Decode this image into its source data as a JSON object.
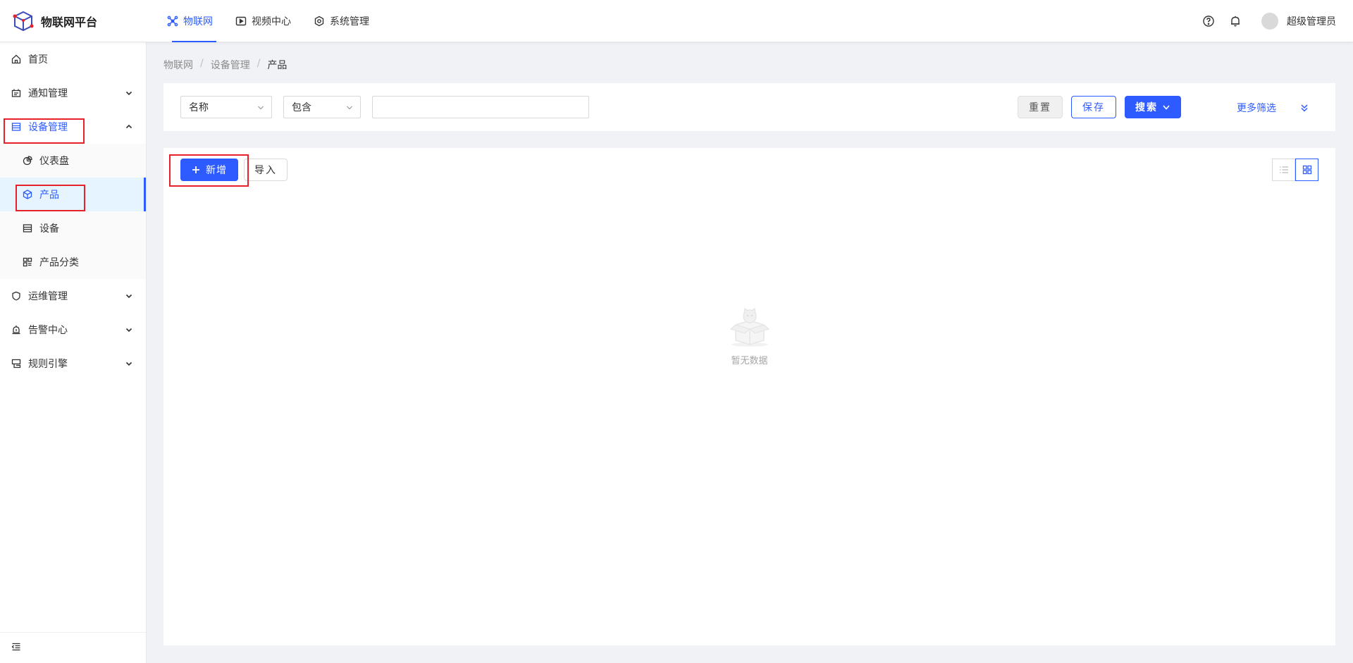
{
  "app": {
    "title": "物联网平台"
  },
  "topnav": {
    "items": [
      {
        "label": "物联网",
        "icon": "iot-icon",
        "active": true
      },
      {
        "label": "视频中心",
        "icon": "video-play-icon",
        "active": false
      },
      {
        "label": "系统管理",
        "icon": "system-settings-icon",
        "active": false
      }
    ]
  },
  "user": {
    "name": "超级管理员"
  },
  "sidebar": {
    "items": [
      {
        "label": "首页",
        "icon": "home-icon"
      },
      {
        "label": "通知管理",
        "icon": "notice-icon",
        "expandable": true
      },
      {
        "label": "设备管理",
        "icon": "device-management-icon",
        "expandable": true,
        "open": true,
        "children": [
          {
            "label": "仪表盘",
            "icon": "dashboard-pie-icon"
          },
          {
            "label": "产品",
            "icon": "product-cube-icon",
            "selected": true
          },
          {
            "label": "设备",
            "icon": "device-list-icon"
          },
          {
            "label": "产品分类",
            "icon": "category-grid-icon"
          }
        ]
      },
      {
        "label": "运维管理",
        "icon": "operations-shield-icon",
        "expandable": true
      },
      {
        "label": "告警中心",
        "icon": "alarm-icon",
        "expandable": true
      },
      {
        "label": "规则引擎",
        "icon": "rule-engine-icon",
        "expandable": true
      }
    ]
  },
  "breadcrumb": {
    "items": [
      "物联网",
      "设备管理",
      "产品"
    ]
  },
  "filter": {
    "field_select": "名称",
    "operator_select": "包含",
    "value": "",
    "reset_label": "重置",
    "save_label": "保存",
    "search_label": "搜索",
    "more_label": "更多筛选"
  },
  "toolbar": {
    "add_label": "新增",
    "import_label": "导入"
  },
  "empty": {
    "text": "暂无数据"
  },
  "colors": {
    "accent": "#2d5bff",
    "highlight": "#e8202a"
  }
}
